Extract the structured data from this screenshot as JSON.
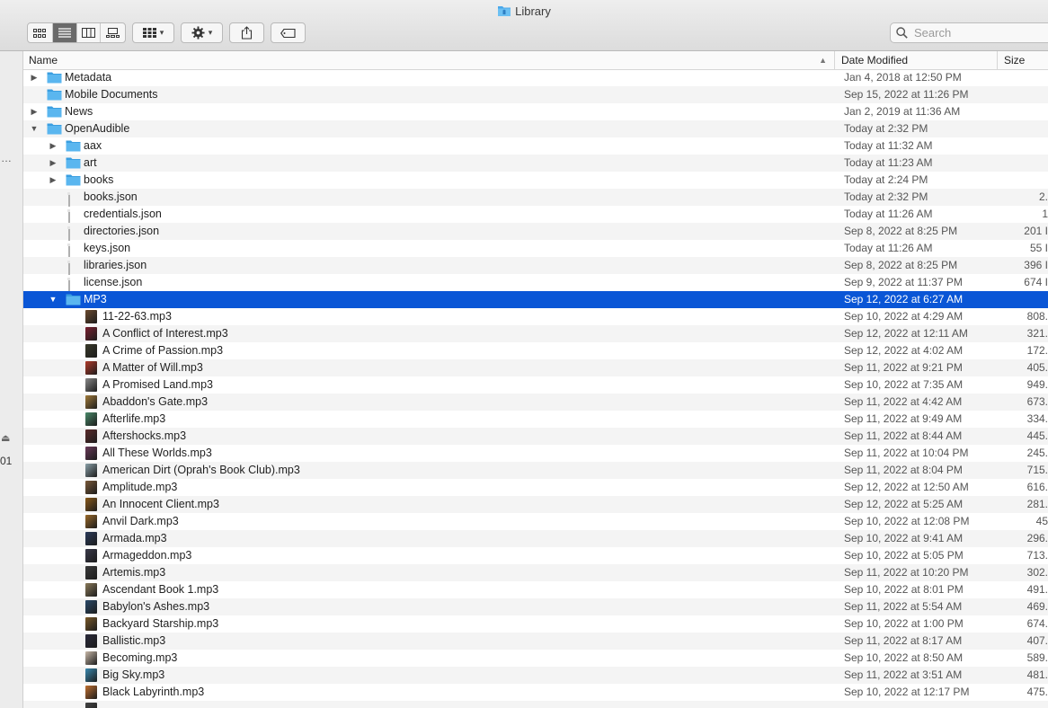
{
  "window": {
    "title": "Library"
  },
  "toolbar": {
    "search_placeholder": "Search"
  },
  "sidebar": {
    "dots": "…",
    "number_fragment": "01"
  },
  "columns": {
    "name": "Name",
    "date": "Date Modified",
    "size": "Size"
  },
  "rows": [
    {
      "name": "Metadata",
      "date": "Jan 4, 2018 at 12:50 PM",
      "size": "",
      "kind": "folder",
      "level": 0,
      "disclosure": "closed"
    },
    {
      "name": "Mobile Documents",
      "date": "Sep 15, 2022 at 11:26 PM",
      "size": "",
      "kind": "folder",
      "level": 0,
      "disclosure": "none"
    },
    {
      "name": "News",
      "date": "Jan 2, 2019 at 11:36 AM",
      "size": "",
      "kind": "folder",
      "level": 0,
      "disclosure": "closed"
    },
    {
      "name": "OpenAudible",
      "date": "Today at 2:32 PM",
      "size": "",
      "kind": "folder",
      "level": 0,
      "disclosure": "open"
    },
    {
      "name": "aax",
      "date": "Today at 11:32 AM",
      "size": "",
      "kind": "folder",
      "level": 1,
      "disclosure": "closed"
    },
    {
      "name": "art",
      "date": "Today at 11:23 AM",
      "size": "",
      "kind": "folder",
      "level": 1,
      "disclosure": "closed"
    },
    {
      "name": "books",
      "date": "Today at 2:24 PM",
      "size": "",
      "kind": "folder",
      "level": 1,
      "disclosure": "closed"
    },
    {
      "name": "books.json",
      "date": "Today at 2:32 PM",
      "size": "2.",
      "kind": "doc",
      "level": 1,
      "disclosure": "none"
    },
    {
      "name": "credentials.json",
      "date": "Today at 11:26 AM",
      "size": "1",
      "kind": "doc",
      "level": 1,
      "disclosure": "none"
    },
    {
      "name": "directories.json",
      "date": "Sep 8, 2022 at 8:25 PM",
      "size": "201 I",
      "kind": "doc",
      "level": 1,
      "disclosure": "none"
    },
    {
      "name": "keys.json",
      "date": "Today at 11:26 AM",
      "size": "55 I",
      "kind": "doc",
      "level": 1,
      "disclosure": "none"
    },
    {
      "name": "libraries.json",
      "date": "Sep 8, 2022 at 8:25 PM",
      "size": "396 I",
      "kind": "doc",
      "level": 1,
      "disclosure": "none"
    },
    {
      "name": "license.json",
      "date": "Sep 9, 2022 at 11:37 PM",
      "size": "674 I",
      "kind": "doc",
      "level": 1,
      "disclosure": "none"
    },
    {
      "name": "MP3",
      "date": "Sep 12, 2022 at 6:27 AM",
      "size": "",
      "kind": "folder",
      "level": 1,
      "disclosure": "open",
      "selected": true
    },
    {
      "name": "11-22-63.mp3",
      "date": "Sep 10, 2022 at 4:29 AM",
      "size": "808.",
      "kind": "mp3",
      "level": 2,
      "disclosure": "none",
      "color": "#6b4a2e"
    },
    {
      "name": "A Conflict of Interest.mp3",
      "date": "Sep 12, 2022 at 12:11 AM",
      "size": "321.",
      "kind": "mp3",
      "level": 2,
      "disclosure": "none",
      "color": "#7a2030"
    },
    {
      "name": "A Crime of Passion.mp3",
      "date": "Sep 12, 2022 at 4:02 AM",
      "size": "172.",
      "kind": "mp3",
      "level": 2,
      "disclosure": "none",
      "color": "#3a3a2a"
    },
    {
      "name": "A Matter of Will.mp3",
      "date": "Sep 11, 2022 at 9:21 PM",
      "size": "405.",
      "kind": "mp3",
      "level": 2,
      "disclosure": "none",
      "color": "#b03a2a"
    },
    {
      "name": "A Promised Land.mp3",
      "date": "Sep 10, 2022 at 7:35 AM",
      "size": "949.",
      "kind": "mp3",
      "level": 2,
      "disclosure": "none",
      "color": "#8a8a8a"
    },
    {
      "name": "Abaddon's Gate.mp3",
      "date": "Sep 11, 2022 at 4:42 AM",
      "size": "673.",
      "kind": "mp3",
      "level": 2,
      "disclosure": "none",
      "color": "#a07a3a"
    },
    {
      "name": "Afterlife.mp3",
      "date": "Sep 11, 2022 at 9:49 AM",
      "size": "334.",
      "kind": "mp3",
      "level": 2,
      "disclosure": "none",
      "color": "#4a8a6a"
    },
    {
      "name": "Aftershocks.mp3",
      "date": "Sep 11, 2022 at 8:44 AM",
      "size": "445.",
      "kind": "mp3",
      "level": 2,
      "disclosure": "none",
      "color": "#5a2a2a"
    },
    {
      "name": "All These Worlds.mp3",
      "date": "Sep 11, 2022 at 10:04 PM",
      "size": "245.",
      "kind": "mp3",
      "level": 2,
      "disclosure": "none",
      "color": "#6a3a5a"
    },
    {
      "name": "American Dirt (Oprah's Book Club).mp3",
      "date": "Sep 11, 2022 at 8:04 PM",
      "size": "715.",
      "kind": "mp3",
      "level": 2,
      "disclosure": "none",
      "color": "#8aa0a8"
    },
    {
      "name": "Amplitude.mp3",
      "date": "Sep 12, 2022 at 12:50 AM",
      "size": "616.",
      "kind": "mp3",
      "level": 2,
      "disclosure": "none",
      "color": "#7a5a3a"
    },
    {
      "name": "An Innocent Client.mp3",
      "date": "Sep 12, 2022 at 5:25 AM",
      "size": "281.",
      "kind": "mp3",
      "level": 2,
      "disclosure": "none",
      "color": "#8a5a1a"
    },
    {
      "name": "Anvil Dark.mp3",
      "date": "Sep 10, 2022 at 12:08 PM",
      "size": "45",
      "kind": "mp3",
      "level": 2,
      "disclosure": "none",
      "color": "#9a6a2a"
    },
    {
      "name": "Armada.mp3",
      "date": "Sep 10, 2022 at 9:41 AM",
      "size": "296.",
      "kind": "mp3",
      "level": 2,
      "disclosure": "none",
      "color": "#2a3a5a"
    },
    {
      "name": "Armageddon.mp3",
      "date": "Sep 10, 2022 at 5:05 PM",
      "size": "713.",
      "kind": "mp3",
      "level": 2,
      "disclosure": "none",
      "color": "#3a3a4a"
    },
    {
      "name": "Artemis.mp3",
      "date": "Sep 11, 2022 at 10:20 PM",
      "size": "302.",
      "kind": "mp3",
      "level": 2,
      "disclosure": "none",
      "color": "#3a3a3a"
    },
    {
      "name": "Ascendant Book 1.mp3",
      "date": "Sep 10, 2022 at 8:01 PM",
      "size": "491.",
      "kind": "mp3",
      "level": 2,
      "disclosure": "none",
      "color": "#8a7a5a"
    },
    {
      "name": "Babylon's Ashes.mp3",
      "date": "Sep 11, 2022 at 5:54 AM",
      "size": "469.",
      "kind": "mp3",
      "level": 2,
      "disclosure": "none",
      "color": "#2a4a6a"
    },
    {
      "name": "Backyard Starship.mp3",
      "date": "Sep 10, 2022 at 1:00 PM",
      "size": "674.",
      "kind": "mp3",
      "level": 2,
      "disclosure": "none",
      "color": "#7a5a2a"
    },
    {
      "name": "Ballistic.mp3",
      "date": "Sep 11, 2022 at 8:17 AM",
      "size": "407.",
      "kind": "mp3",
      "level": 2,
      "disclosure": "none",
      "color": "#2a2a3a"
    },
    {
      "name": "Becoming.mp3",
      "date": "Sep 10, 2022 at 8:50 AM",
      "size": "589.",
      "kind": "mp3",
      "level": 2,
      "disclosure": "none",
      "color": "#c8b8a8"
    },
    {
      "name": "Big Sky.mp3",
      "date": "Sep 11, 2022 at 3:51 AM",
      "size": "481.",
      "kind": "mp3",
      "level": 2,
      "disclosure": "none",
      "color": "#3a8ab0"
    },
    {
      "name": "Black Labyrinth.mp3",
      "date": "Sep 10, 2022 at 12:17 PM",
      "size": "475.",
      "kind": "mp3",
      "level": 2,
      "disclosure": "none",
      "color": "#c07030"
    },
    {
      "name": "",
      "date": "",
      "size": "",
      "kind": "mp3",
      "level": 2,
      "disclosure": "none",
      "color": "#444444"
    }
  ],
  "colors": {
    "selection": "#0a56d6",
    "folder": "#5ab6ef",
    "folder_dark": "#3a9ee0"
  }
}
